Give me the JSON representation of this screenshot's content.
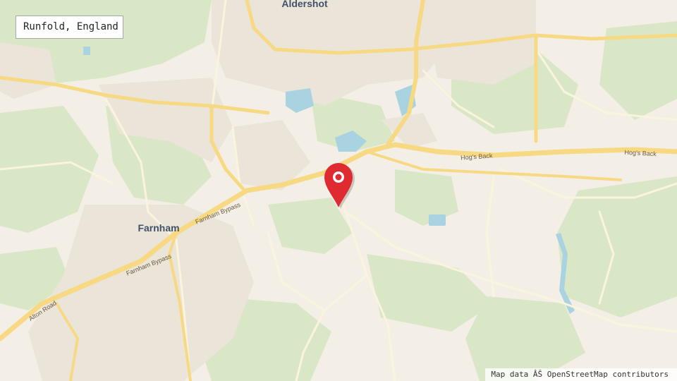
{
  "location_label": "Runfold, England",
  "attribution": "Map data ÂŠ OpenStreetMap contributors",
  "places": {
    "aldershot": "Aldershot",
    "farnham": "Farnham"
  },
  "roads": {
    "hogs_back_1": "Hog's Back",
    "hogs_back_2": "Hog's Back",
    "farnham_bypass_1": "Farnham Bypass",
    "farnham_bypass_2": "Farnham Bypass",
    "alton_road": "Alton Road"
  },
  "colors": {
    "background": "#f3efe6",
    "woodland": "#d7e6c4",
    "urban": "#ece6dc",
    "water": "#aad3df",
    "major_road": "#f7dc84",
    "minor_road": "#fbf3d9",
    "marker": "#e02a31"
  },
  "marker_icon": "map-pin-icon"
}
